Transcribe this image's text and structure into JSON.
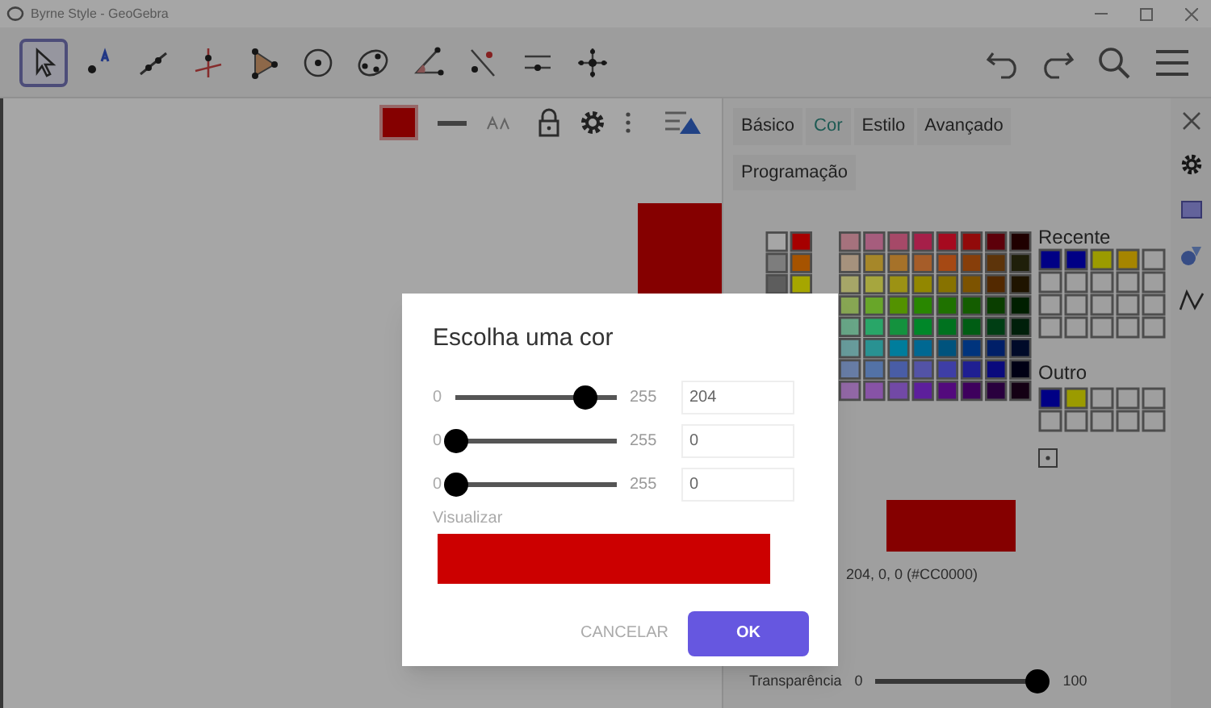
{
  "window": {
    "title": "Byrne Style - GeoGebra"
  },
  "toolbar": {
    "tools": [
      {
        "kind": "pointer",
        "selected": true
      },
      {
        "kind": "point",
        "selected": false
      },
      {
        "kind": "line",
        "selected": false
      },
      {
        "kind": "perpendicular",
        "selected": false
      },
      {
        "kind": "polygon",
        "selected": false
      },
      {
        "kind": "circle",
        "selected": false
      },
      {
        "kind": "conic",
        "selected": false
      },
      {
        "kind": "angle",
        "selected": false
      },
      {
        "kind": "reflect",
        "selected": false
      },
      {
        "kind": "slider",
        "selected": false
      },
      {
        "kind": "move",
        "selected": false
      }
    ]
  },
  "properties": {
    "tabs": [
      {
        "label": "Básico",
        "selected": false
      },
      {
        "label": "Cor",
        "selected": true
      },
      {
        "label": "Estilo",
        "selected": false
      },
      {
        "label": "Avançado",
        "selected": false
      },
      {
        "label": "Programação",
        "selected": false
      }
    ],
    "recent_label": "Recente",
    "other_label": "Outro",
    "color_reading": "204, 0, 0 (#CC0000)",
    "transparency": {
      "label": "Transparência",
      "min": "0",
      "max": "100",
      "level": 1
    }
  },
  "dialog": {
    "title": "Escolha uma cor",
    "channels": [
      {
        "min": "0",
        "max": "255",
        "value": "204",
        "level": 0.8
      },
      {
        "min": "0",
        "max": "255",
        "value": "0",
        "level": 0
      },
      {
        "min": "0",
        "max": "255",
        "value": "0",
        "level": 0
      }
    ],
    "preview_label": "Visualizar",
    "buttons": [
      {
        "label": "CANCELAR",
        "kind": "text"
      },
      {
        "label": "OK",
        "kind": "primary"
      }
    ]
  }
}
